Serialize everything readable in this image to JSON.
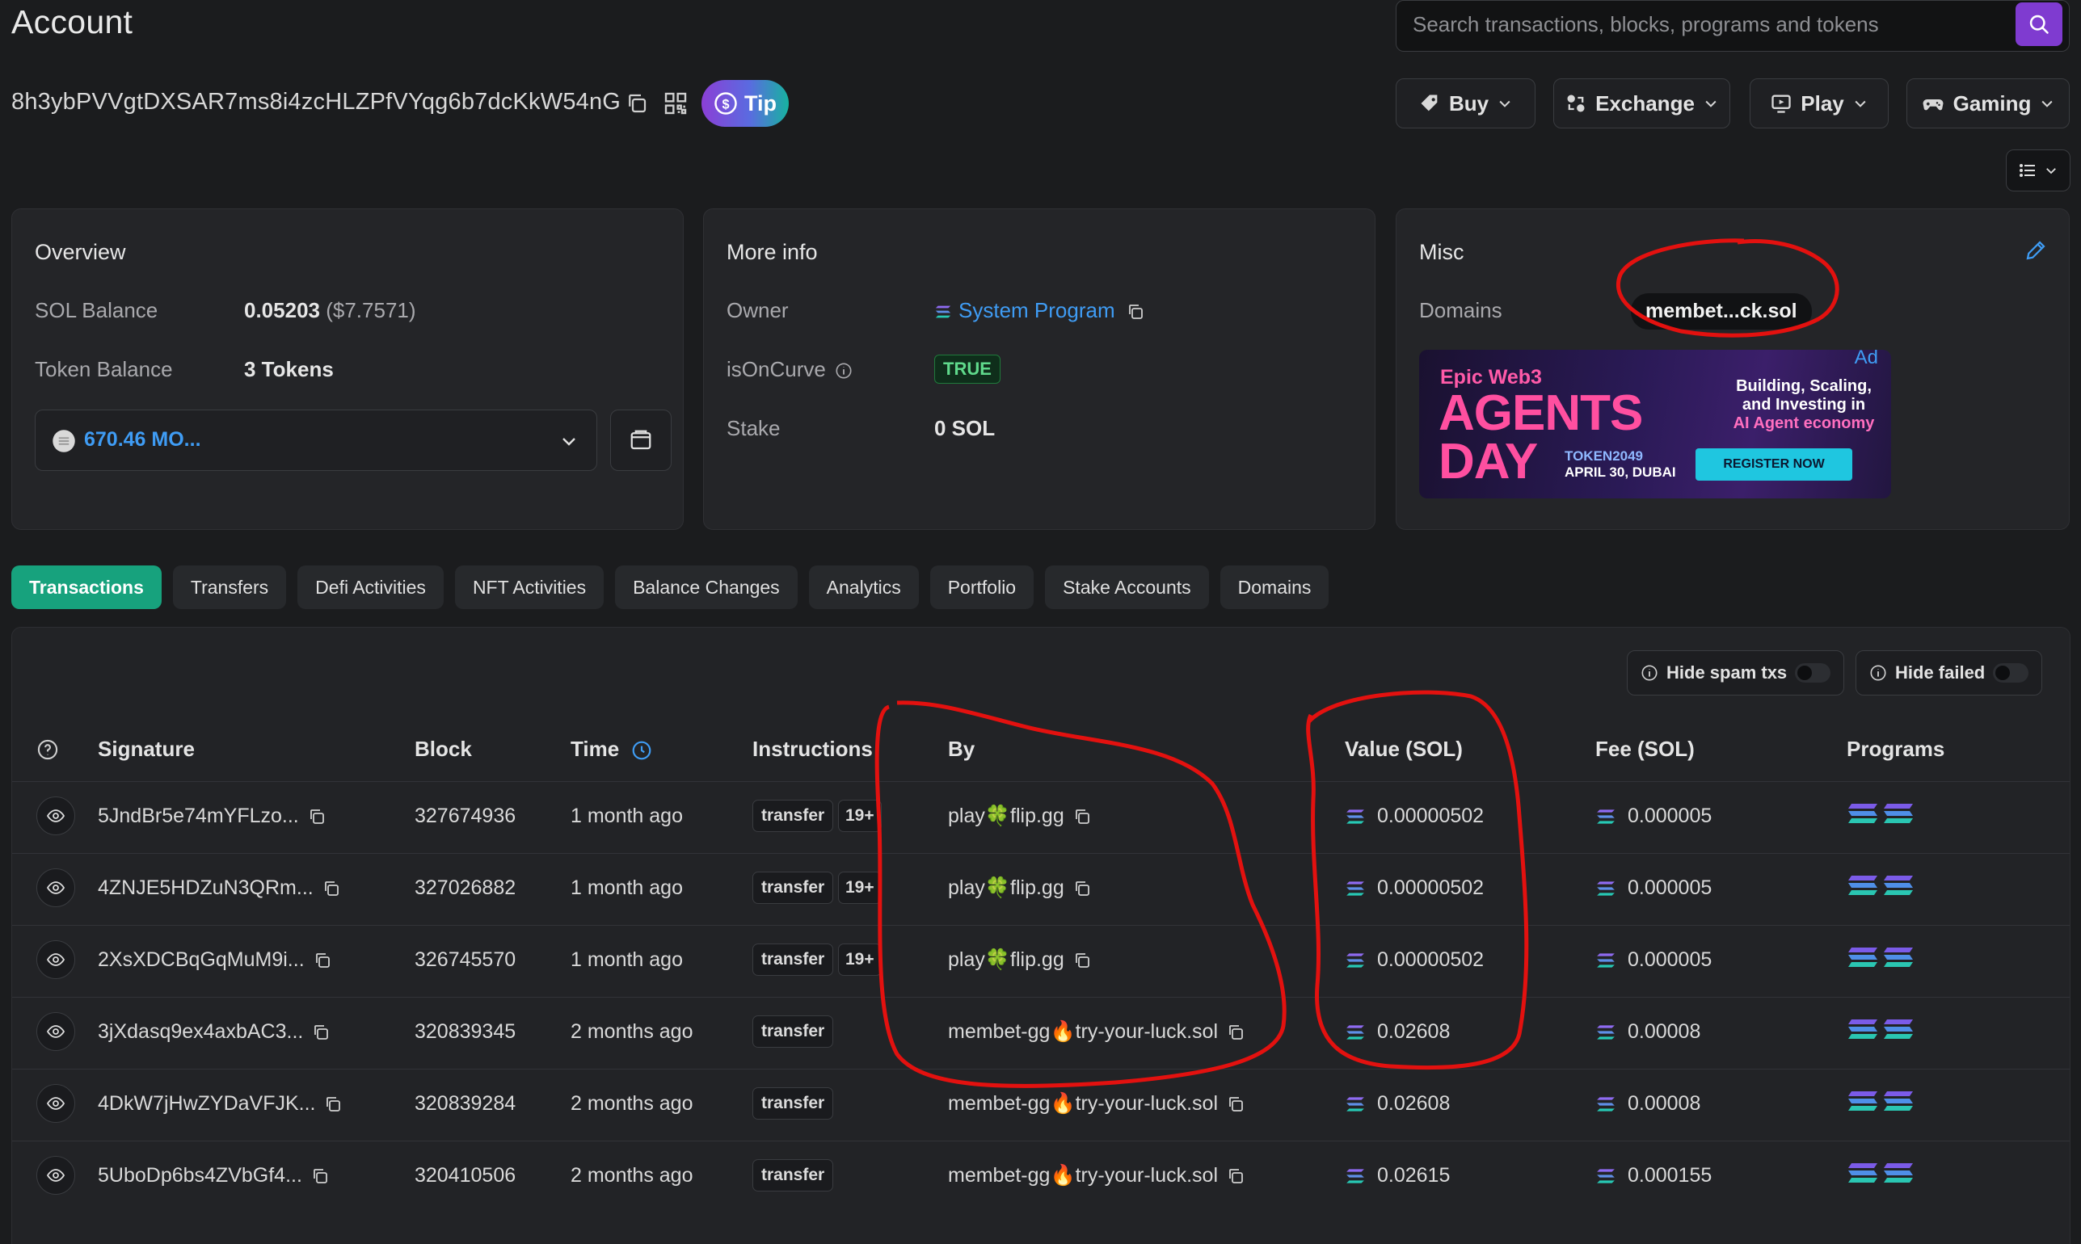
{
  "header": {
    "title": "Account",
    "search_placeholder": "Search transactions, blocks, programs and tokens",
    "address": "8h3ybPVVgtDXSAR7ms8i4zcHLZPfVYqg6b7dcKkW54nG",
    "tip_label": "Tip",
    "menus": [
      {
        "label": "Buy",
        "icon": "tag-icon"
      },
      {
        "label": "Exchange",
        "icon": "exchange-icon"
      },
      {
        "label": "Play",
        "icon": "monitor-play-icon"
      },
      {
        "label": "Gaming",
        "icon": "gamepad-icon"
      }
    ]
  },
  "overview": {
    "title": "Overview",
    "sol_balance_label": "SOL Balance",
    "sol_balance_value": "0.05203",
    "sol_balance_usd": "($7.7571)",
    "token_balance_label": "Token Balance",
    "token_balance_value": "3 Tokens",
    "token_select_value": "670.46 MO..."
  },
  "more_info": {
    "title": "More info",
    "owner_label": "Owner",
    "owner_value": "System Program",
    "oncurve_label": "isOnCurve",
    "oncurve_value": "TRUE",
    "stake_label": "Stake",
    "stake_value": "0 SOL"
  },
  "misc": {
    "title": "Misc",
    "domains_label": "Domains",
    "domain_value": "membet...ck.sol",
    "ad_label": "Ad",
    "ad": {
      "brand": "Epic Web3",
      "headline_1": "AGENTS",
      "headline_2": "DAY",
      "event": "TOKEN2049",
      "date": "APRIL 30, DUBAI",
      "tagline_1": "Building, Scaling,",
      "tagline_2": "and Investing in",
      "tagline_3": "AI Agent economy",
      "cta": "REGISTER NOW"
    }
  },
  "tabs": [
    "Transactions",
    "Transfers",
    "Defi Activities",
    "NFT Activities",
    "Balance Changes",
    "Analytics",
    "Portfolio",
    "Stake Accounts",
    "Domains"
  ],
  "filters": {
    "hide_spam": "Hide spam txs",
    "hide_failed": "Hide failed"
  },
  "table": {
    "headers": {
      "signature": "Signature",
      "block": "Block",
      "time": "Time",
      "instructions": "Instructions",
      "by": "By",
      "value": "Value (SOL)",
      "fee": "Fee (SOL)",
      "programs": "Programs"
    },
    "rows": [
      {
        "signature": "5JndBr5e74mYFLzo...",
        "block": "327674936",
        "time": "1 month ago",
        "instruction": "transfer",
        "extra": "19+",
        "by_a": "play",
        "by_emoji": "🍀",
        "by_b": "flip.gg",
        "by_link": true,
        "value": "0.00000502",
        "fee": "0.000005"
      },
      {
        "signature": "4ZNJE5HDZuN3QRm...",
        "block": "327026882",
        "time": "1 month ago",
        "instruction": "transfer",
        "extra": "19+",
        "by_a": "play",
        "by_emoji": "🍀",
        "by_b": "flip.gg",
        "by_link": true,
        "value": "0.00000502",
        "fee": "0.000005"
      },
      {
        "signature": "2XsXDCBqGqMuM9i...",
        "block": "326745570",
        "time": "1 month ago",
        "instruction": "transfer",
        "extra": "19+",
        "by_a": "play",
        "by_emoji": "🍀",
        "by_b": "flip.gg",
        "by_link": true,
        "value": "0.00000502",
        "fee": "0.000005"
      },
      {
        "signature": "3jXdasq9ex4axbAC3...",
        "block": "320839345",
        "time": "2 months ago",
        "instruction": "transfer",
        "extra": "",
        "by_a": "membet-gg",
        "by_emoji": "🔥",
        "by_b": "try-your-luck.sol",
        "by_link": false,
        "value": "0.02608",
        "fee": "0.00008"
      },
      {
        "signature": "4DkW7jHwZYDaVFJK...",
        "block": "320839284",
        "time": "2 months ago",
        "instruction": "transfer",
        "extra": "",
        "by_a": "membet-gg",
        "by_emoji": "🔥",
        "by_b": "try-your-luck.sol",
        "by_link": false,
        "value": "0.02608",
        "fee": "0.00008"
      },
      {
        "signature": "5UboDp6bs4ZVbGf4...",
        "block": "320410506",
        "time": "2 months ago",
        "instruction": "transfer",
        "extra": "",
        "by_a": "membet-gg",
        "by_emoji": "🔥",
        "by_b": "try-your-luck.sol",
        "by_link": false,
        "value": "0.02615",
        "fee": "0.000155"
      }
    ]
  },
  "colors": {
    "accent_green": "#17a27d",
    "link_blue": "#3f9cf4",
    "annotation_red": "#e3110f",
    "search_purple": "#7f3bd0"
  }
}
